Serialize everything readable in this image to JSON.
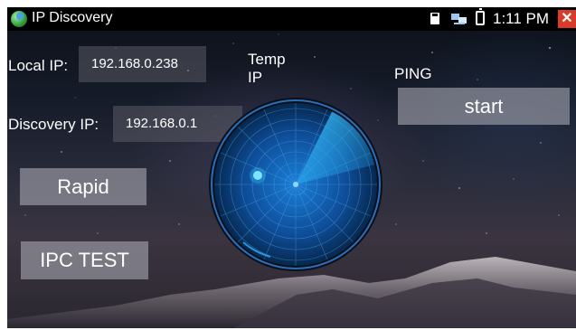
{
  "status_bar": {
    "app_title": "IP Discovery",
    "time": "1:11 PM",
    "icons": [
      "app-icon",
      "sd-card-icon",
      "network-icon",
      "battery-icon",
      "close-icon"
    ],
    "close_glyph": "✕"
  },
  "form": {
    "local_ip_label": "Local IP:",
    "local_ip_value": "192.168.0.238",
    "discovery_ip_label": "Discovery IP:",
    "discovery_ip_value": "192.168.0.1",
    "temp_ip_label_line1": "Temp",
    "temp_ip_label_line2": "IP"
  },
  "ping": {
    "label": "PING",
    "start_button": "start"
  },
  "buttons": {
    "rapid": "Rapid",
    "ipc_test": "IPC TEST"
  },
  "colors": {
    "close_button": "#d93b2b",
    "radar_accent": "#1fa8f0",
    "status_bar": "#000000"
  }
}
